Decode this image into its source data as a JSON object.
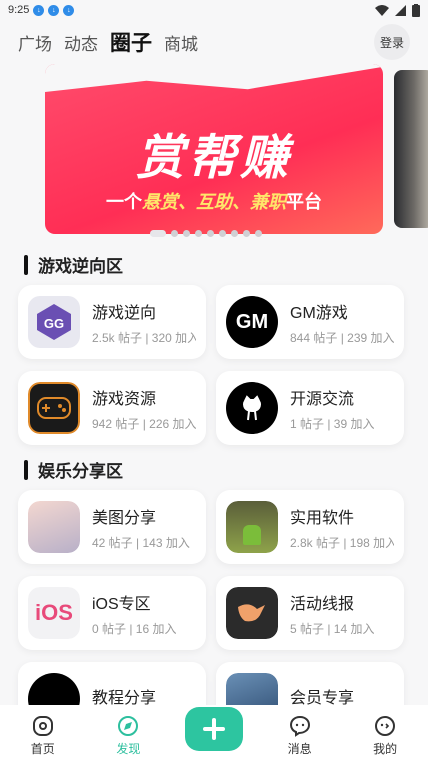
{
  "status": {
    "time": "9:25"
  },
  "header": {
    "tabs": [
      {
        "label": "广场",
        "active": false
      },
      {
        "label": "动态",
        "active": false
      },
      {
        "label": "圈子",
        "active": true
      },
      {
        "label": "商城",
        "active": false
      }
    ],
    "login_label": "登录"
  },
  "banner": {
    "title": "赏帮赚",
    "sub_prefix": "一个",
    "sub_hl": "悬赏、互助、兼职",
    "sub_suffix": "平台",
    "dot_count": 9,
    "active_dot": 0
  },
  "sections": [
    {
      "title": "游戏逆向区",
      "items": [
        {
          "name": "游戏逆向",
          "stats": "2.5k 帖子 | 320 加入",
          "icon": "gg-icon"
        },
        {
          "name": "GM游戏",
          "stats": "844 帖子 | 239 加入",
          "icon": "gm-icon"
        },
        {
          "name": "游戏资源",
          "stats": "942 帖子 | 226 加入",
          "icon": "gamepad-icon"
        },
        {
          "name": "开源交流",
          "stats": "1 帖子 | 39 加入",
          "icon": "github-icon"
        }
      ]
    },
    {
      "title": "娱乐分享区",
      "items": [
        {
          "name": "美图分享",
          "stats": "42 帖子 | 143 加入",
          "icon": "anime-art-icon"
        },
        {
          "name": "实用软件",
          "stats": "2.8k 帖子 | 198 加入",
          "icon": "android-umbrella-icon"
        },
        {
          "name": "iOS专区",
          "stats": "0 帖子 | 16 加入",
          "icon": "ios-icon"
        },
        {
          "name": "活动线报",
          "stats": "5 帖子 | 14 加入",
          "icon": "bird-icon"
        },
        {
          "name": "教程分享",
          "stats": "",
          "icon": "tutorial-icon"
        },
        {
          "name": "会员专享",
          "stats": "",
          "icon": "vip-badge-icon"
        }
      ]
    }
  ],
  "tabbar": [
    {
      "label": "首页",
      "icon": "home-icon"
    },
    {
      "label": "发现",
      "icon": "compass-icon",
      "active": true
    },
    {
      "label": "",
      "icon": "plus-icon"
    },
    {
      "label": "消息",
      "icon": "message-icon"
    },
    {
      "label": "我的",
      "icon": "profile-icon"
    }
  ],
  "colors": {
    "accent": "#2dc5a0",
    "banner": "#ff2e55"
  }
}
